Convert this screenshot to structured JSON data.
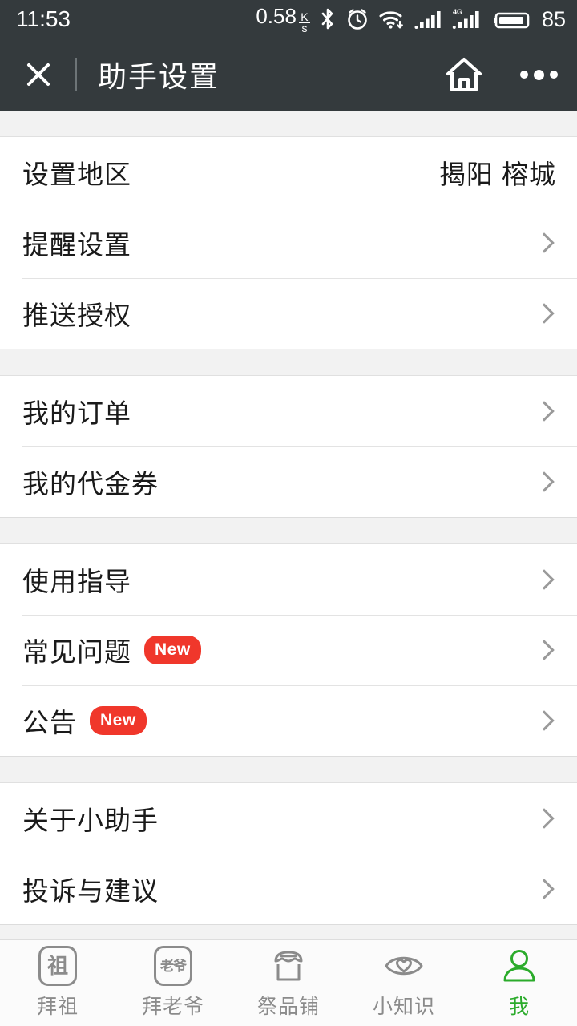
{
  "statusbar": {
    "time": "11:53",
    "network_speed": "0.58",
    "speed_unit_top": "K",
    "speed_unit_bottom": "s",
    "bluetooth_icon": "bluetooth-icon",
    "alarm_icon": "alarm-clock-icon",
    "wifi_icon": "wifi-icon",
    "signal_icon": "signal-bars-icon",
    "signal_4g_icon": "signal-bars-4g-icon",
    "signal_4g_label": "4G",
    "battery_icon": "battery-icon",
    "battery_level": "85"
  },
  "titlebar": {
    "close_label": "close-icon",
    "title": "助手设置",
    "home_label": "home-icon",
    "more_label": "more-options-icon"
  },
  "colors": {
    "header_bg": "#343a3d",
    "page_bg": "#f2f2f2",
    "row_bg": "#ffffff",
    "badge_red": "#f0372b",
    "active_green": "#2bab2b",
    "chevron_gray": "#9a9a9a",
    "label_gray": "#8b8b8b"
  },
  "groups": [
    {
      "rows": [
        {
          "label": "设置地区",
          "value": "揭阳 榕城",
          "chevron": false,
          "badge": null
        },
        {
          "label": "提醒设置",
          "value": null,
          "chevron": true,
          "badge": null
        },
        {
          "label": "推送授权",
          "value": null,
          "chevron": true,
          "badge": null
        }
      ]
    },
    {
      "rows": [
        {
          "label": "我的订单",
          "value": null,
          "chevron": true,
          "badge": null
        },
        {
          "label": "我的代金券",
          "value": null,
          "chevron": true,
          "badge": null
        }
      ]
    },
    {
      "rows": [
        {
          "label": "使用指导",
          "value": null,
          "chevron": true,
          "badge": null
        },
        {
          "label": "常见问题",
          "value": null,
          "chevron": true,
          "badge": "New"
        },
        {
          "label": "公告",
          "value": null,
          "chevron": true,
          "badge": "New"
        }
      ]
    },
    {
      "rows": [
        {
          "label": "关于小助手",
          "value": null,
          "chevron": true,
          "badge": null
        },
        {
          "label": "投诉与建议",
          "value": null,
          "chevron": true,
          "badge": null
        }
      ]
    }
  ],
  "tabbar": {
    "items": [
      {
        "label": "拜祖",
        "icon": "ancestor-tablet-icon",
        "glyph": "祖",
        "active": false
      },
      {
        "label": "拜老爷",
        "icon": "deity-tablet-icon",
        "glyph": "老爷",
        "active": false
      },
      {
        "label": "祭品铺",
        "icon": "shop-icon",
        "glyph": null,
        "active": false
      },
      {
        "label": "小知识",
        "icon": "eye-heart-icon",
        "glyph": null,
        "active": false
      },
      {
        "label": "我",
        "icon": "person-icon",
        "glyph": null,
        "active": true
      }
    ]
  }
}
